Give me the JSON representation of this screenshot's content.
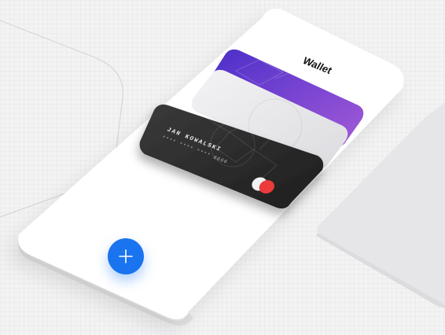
{
  "app": {
    "title": "Wallet"
  },
  "card": {
    "holder_name": "JAN KOWALSKI",
    "number_masked": "**** **** **** 6666",
    "brand": "mastercard"
  },
  "actions": {
    "add_icon": "plus-icon"
  },
  "colors": {
    "accent": "#1a74f0",
    "card_dark": "#2a2a2a",
    "card_purple": "#6a3fd6",
    "card_silver": "#e9e9ec",
    "brand_red": "#eb3b3b",
    "brand_light": "#f2f2f2"
  }
}
